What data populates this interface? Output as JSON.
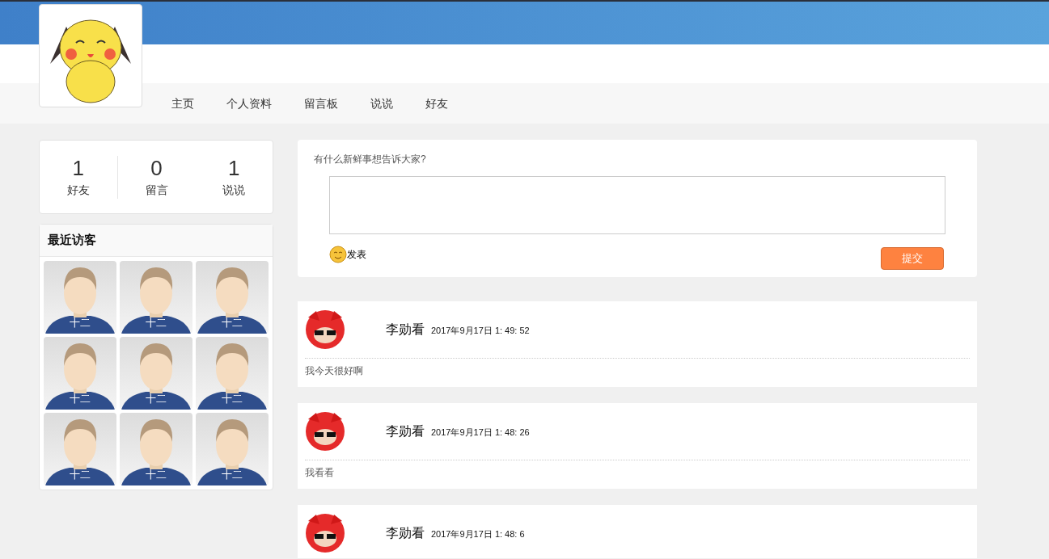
{
  "nav": [
    "主页",
    "个人资料",
    "留言板",
    "说说",
    "好友"
  ],
  "stats": [
    {
      "value": "1",
      "label": "好友"
    },
    {
      "value": "0",
      "label": "留言"
    },
    {
      "value": "1",
      "label": "说说"
    }
  ],
  "visitors": {
    "title": "最近访客",
    "items": [
      {
        "name": "十二"
      },
      {
        "name": "十二"
      },
      {
        "name": "十二"
      },
      {
        "name": "十二"
      },
      {
        "name": "十二"
      },
      {
        "name": "十二"
      },
      {
        "name": "十二"
      },
      {
        "name": "十二"
      },
      {
        "name": "十二"
      }
    ]
  },
  "composer": {
    "prompt": "有什么新鲜事想告诉大家?",
    "emoji_label": "发表",
    "submit": "提交"
  },
  "posts": [
    {
      "author": "李勋看",
      "time": "2017年9月17日 1: 49: 52",
      "content": "我今天很好啊"
    },
    {
      "author": "李勋看",
      "time": "2017年9月17日 1: 48: 26",
      "content": "我看看"
    },
    {
      "author": "李勋看",
      "time": "2017年9月17日 1: 48: 6"
    }
  ]
}
